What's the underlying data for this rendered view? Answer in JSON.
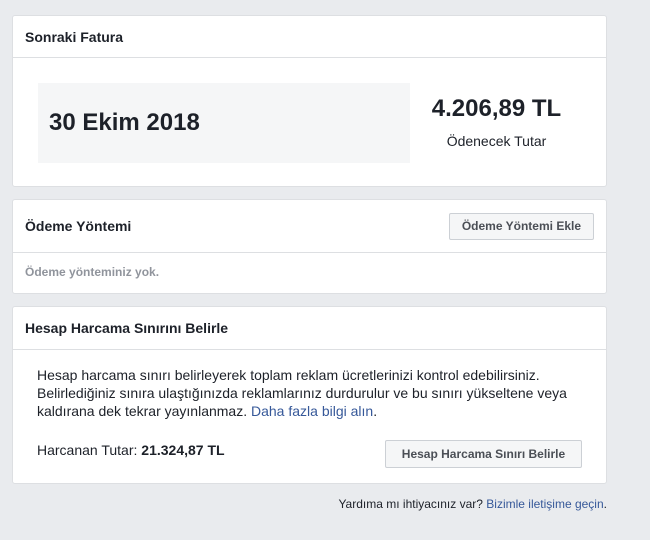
{
  "invoice": {
    "title": "Sonraki Fatura",
    "date": "30 Ekim 2018",
    "amount": "4.206,89 TL",
    "amount_label": "Ödenecek Tutar"
  },
  "payment": {
    "title": "Ödeme Yöntemi",
    "add_button": "Ödeme Yöntemi Ekle",
    "empty_text": "Ödeme yönteminiz yok."
  },
  "limit": {
    "title": "Hesap Harcama Sınırını Belirle",
    "description": "Hesap harcama sınırı belirleyerek toplam reklam ücretlerinizi kontrol edebilirsiniz. Belirlediğiniz sınıra ulaştığınızda reklamlarınız durdurulur ve bu sınırı yükseltene veya kaldırana dek tekrar yayınlanmaz.",
    "learn_more": "Daha fazla bilgi alın",
    "spent_label": "Harcanan Tutar:",
    "spent_value": "21.324,87 TL",
    "button": "Hesap Harcama Sınırı Belirle"
  },
  "help": {
    "question": "Yardıma mı ihtiyacınız var?",
    "contact_link": "Bizimle iletişime geçin"
  },
  "colors": {
    "background": "#e9ebee",
    "link": "#365899",
    "muted": "#90949c"
  }
}
